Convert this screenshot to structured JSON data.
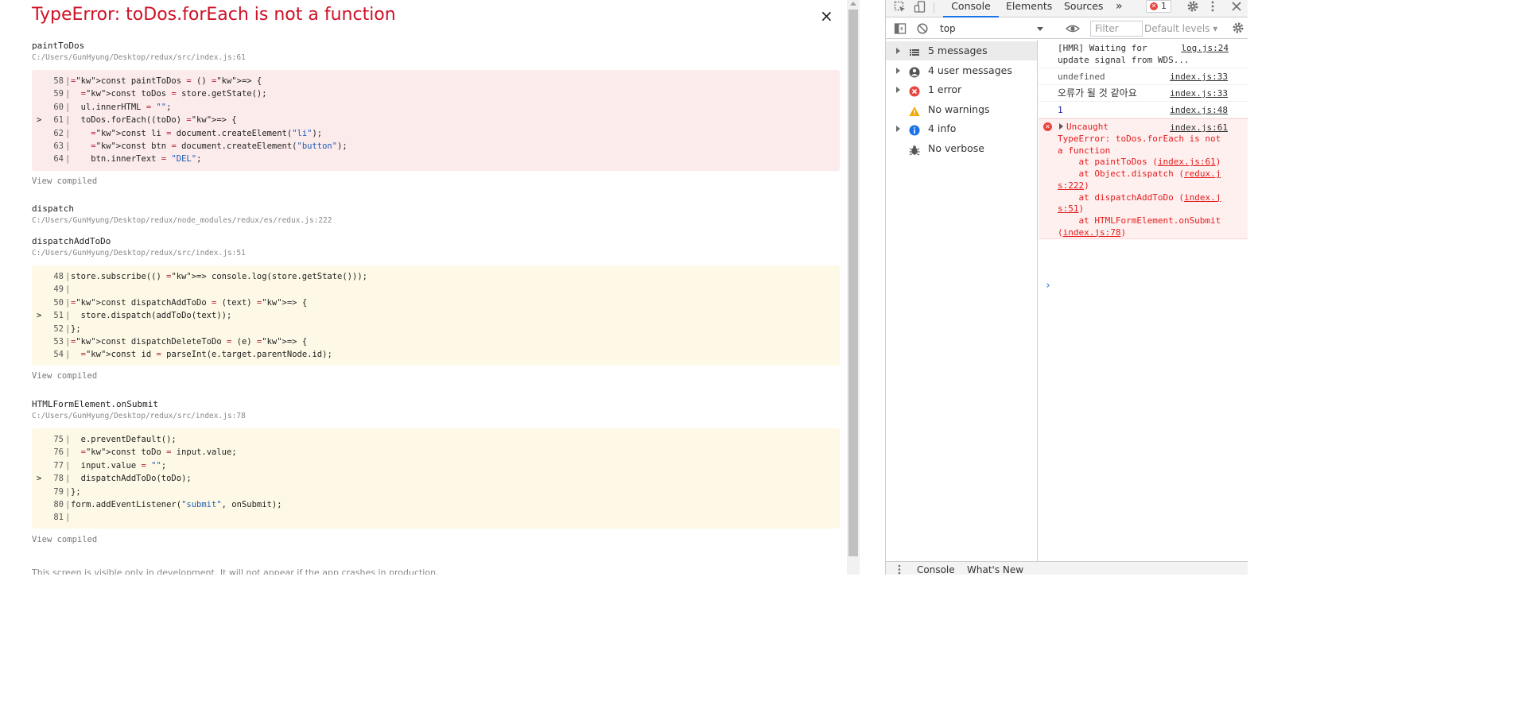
{
  "overlay": {
    "error_title": "TypeError: toDos.forEach is not a function",
    "close_glyph": "×",
    "view_compiled_label": "View compiled",
    "footer_note": "This screen is visible only in development. It will not appear if the app crashes in production.",
    "frames": [
      {
        "function_name": "paintToDos",
        "path": "C:/Users/GunHyung/Desktop/redux/src/index.js:61",
        "tone": "red",
        "lines": [
          {
            "n": "58",
            "mark": "",
            "code": "const paintToDos = () => {"
          },
          {
            "n": "59",
            "mark": "",
            "code": "  const toDos = store.getState();"
          },
          {
            "n": "60",
            "mark": "",
            "code": "  ul.innerHTML = \"\";"
          },
          {
            "n": "61",
            "mark": ">",
            "code": "  toDos.forEach((toDo) => {"
          },
          {
            "n": "62",
            "mark": "",
            "code": "    const li = document.createElement(\"li\");"
          },
          {
            "n": "63",
            "mark": "",
            "code": "    const btn = document.createElement(\"button\");"
          },
          {
            "n": "64",
            "mark": "",
            "code": "    btn.innerText = \"DEL\";"
          }
        ]
      },
      {
        "function_name": "dispatch",
        "path": "C:/Users/GunHyung/Desktop/redux/node_modules/redux/es/redux.js:222"
      },
      {
        "function_name": "dispatchAddToDo",
        "path": "C:/Users/GunHyung/Desktop/redux/src/index.js:51",
        "tone": "yellow",
        "lines": [
          {
            "n": "48",
            "mark": "",
            "code": "store.subscribe(() => console.log(store.getState()));"
          },
          {
            "n": "49",
            "mark": "",
            "code": ""
          },
          {
            "n": "50",
            "mark": "",
            "code": "const dispatchAddToDo = (text) => {"
          },
          {
            "n": "51",
            "mark": ">",
            "code": "  store.dispatch(addToDo(text));"
          },
          {
            "n": "52",
            "mark": "",
            "code": "};"
          },
          {
            "n": "53",
            "mark": "",
            "code": "const dispatchDeleteToDo = (e) => {"
          },
          {
            "n": "54",
            "mark": "",
            "code": "  const id = parseInt(e.target.parentNode.id);"
          }
        ]
      },
      {
        "function_name": "HTMLFormElement.onSubmit",
        "path": "C:/Users/GunHyung/Desktop/redux/src/index.js:78",
        "tone": "yellow",
        "lines": [
          {
            "n": "75",
            "mark": "",
            "code": "  e.preventDefault();"
          },
          {
            "n": "76",
            "mark": "",
            "code": "  const toDo = input.value;"
          },
          {
            "n": "77",
            "mark": "",
            "code": "  input.value = \"\";"
          },
          {
            "n": "78",
            "mark": ">",
            "code": "  dispatchAddToDo(toDo);"
          },
          {
            "n": "79",
            "mark": "",
            "code": "};"
          },
          {
            "n": "80",
            "mark": "",
            "code": "form.addEventListener(\"submit\", onSubmit);"
          },
          {
            "n": "81",
            "mark": "",
            "code": ""
          }
        ]
      }
    ]
  },
  "devtools": {
    "tabs": [
      "Console",
      "Elements",
      "Sources"
    ],
    "more_tabs_glyph": "»",
    "error_badge_count": "1",
    "context": "top",
    "filter_placeholder": "Filter",
    "levels_label": "Default levels ▾",
    "sidebar": [
      {
        "label": "5 messages",
        "icon": "list-icon",
        "expandable": true
      },
      {
        "label": "4 user messages",
        "icon": "user-icon",
        "expandable": true
      },
      {
        "label": "1 error",
        "icon": "error-icon",
        "expandable": true
      },
      {
        "label": "No warnings",
        "icon": "warning-icon",
        "expandable": false
      },
      {
        "label": "4 info",
        "icon": "info-icon",
        "expandable": true
      },
      {
        "label": "No verbose",
        "icon": "bug-icon",
        "expandable": false
      }
    ],
    "messages": [
      {
        "text": "[HMR] Waiting for\nupdate signal from WDS...",
        "source": "log.js:24"
      },
      {
        "text": "undefined",
        "source": "index.js:33"
      },
      {
        "text": "오류가 될 것 같아요",
        "source": "index.js:33"
      },
      {
        "text": "1",
        "source": "index.js:48"
      }
    ],
    "error_message": {
      "label": "Uncaught",
      "source": "index.js:61",
      "lines": [
        "TypeError: toDos.forEach is not",
        "a function",
        "    at paintToDos (index.js:61)",
        "    at Object.dispatch (redux.j",
        "s:222)",
        "    at dispatchAddToDo (index.j",
        "s:51)",
        "    at HTMLFormElement.onSubmit",
        "(index.js:78)"
      ]
    },
    "prompt_glyph": "›",
    "drawer_tabs": [
      "Console",
      "What's New"
    ]
  },
  "colors": {
    "error_red": "#ce1126",
    "code_red_bg": "#fcebeb",
    "code_yellow_bg": "#fdf9e6",
    "devtools_accent": "#1a73e8"
  }
}
